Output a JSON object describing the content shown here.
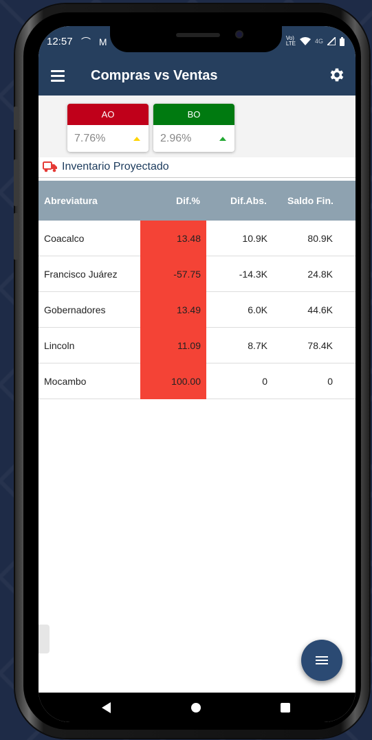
{
  "status": {
    "time": "12:57",
    "left_icons": "⌒ M",
    "right_icons": "4G"
  },
  "appbar": {
    "title": "Compras vs Ventas"
  },
  "cards": [
    {
      "label": "AO",
      "value": "7.76%",
      "header_color": "#c0001a",
      "arrow_color": "#ffd400"
    },
    {
      "label": "BO",
      "value": "2.96%",
      "header_color": "#007a10",
      "arrow_color": "#23a833"
    }
  ],
  "section": {
    "title": "Inventario Proyectado"
  },
  "table": {
    "headers": [
      "Abreviatura",
      "Dif.%",
      "Dif.Abs.",
      "Saldo Fin."
    ],
    "rows": [
      {
        "name": "Coacalco",
        "dif_pct": "13.48",
        "dif_abs": "10.9K",
        "saldo": "80.9K"
      },
      {
        "name": "Francisco Juárez",
        "dif_pct": "-57.75",
        "dif_abs": "-14.3K",
        "saldo": "24.8K"
      },
      {
        "name": "Gobernadores",
        "dif_pct": "13.49",
        "dif_abs": "6.0K",
        "saldo": "44.6K"
      },
      {
        "name": "Lincoln",
        "dif_pct": "11.09",
        "dif_abs": "8.7K",
        "saldo": "78.4K"
      },
      {
        "name": "Mocambo",
        "dif_pct": "100.00",
        "dif_abs": "0",
        "saldo": "0"
      }
    ]
  },
  "colors": {
    "header_bg": "#263f5e",
    "table_head_bg": "#8ea2b0",
    "negative_cell": "#f44336"
  }
}
